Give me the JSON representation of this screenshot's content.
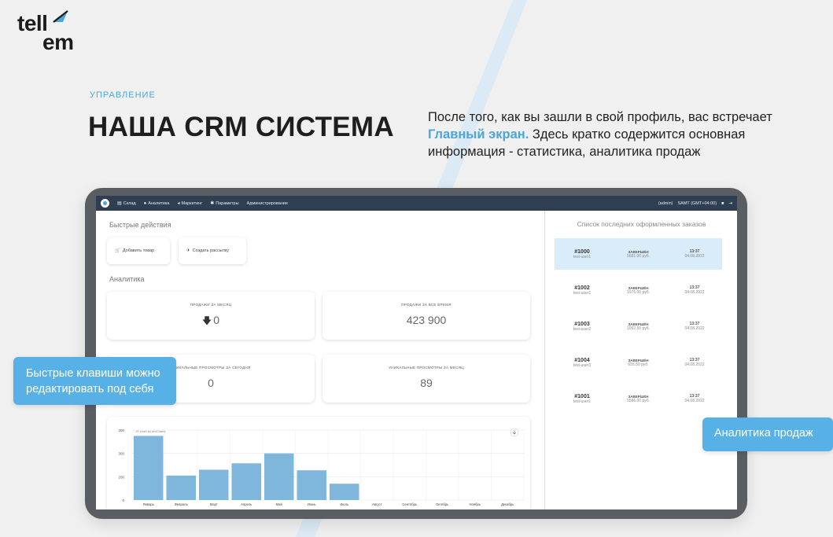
{
  "logo": {
    "part1": "tell",
    "part2": "em"
  },
  "hero": {
    "eyebrow": "УПРАВЛЕНИЕ",
    "title": "НАША CRM СИСТЕМА",
    "lead_before": "После того, как вы зашли в свой профиль, вас встречает ",
    "lead_accent": "Главный экран.",
    "lead_after": " Здесь кратко содержится основная информация - статистика, аналитика продаж"
  },
  "app": {
    "menu": [
      {
        "label": "Склад",
        "icon": "box-icon"
      },
      {
        "label": "Аналитика",
        "icon": "chart-icon"
      },
      {
        "label": "Маркетинг",
        "icon": "megaphone-icon"
      },
      {
        "label": "Параметры",
        "icon": "gear-icon"
      },
      {
        "label": "Администрирование",
        "icon": ""
      }
    ],
    "user": "(admin)",
    "timezone": "SAMT (GMT+04:00)",
    "quick_actions_label": "Быстрые действия",
    "quick_actions": [
      {
        "label": "Добавить товар",
        "icon": "cart-icon"
      },
      {
        "label": "Создать рассылку",
        "icon": "send-icon"
      }
    ],
    "analytics_label": "Аналитика",
    "stats": [
      {
        "caption": "ПРОДАЖИ ЗА МЕСЯЦ",
        "value": "0",
        "trend": "down"
      },
      {
        "caption": "ПРОДАЖИ ЗА ВСЕ ВРЕМЯ",
        "value": "423 900",
        "trend": ""
      },
      {
        "caption": "УНИКАЛЬНЫЕ ПРОСМОТРЫ ЗА СЕГОДНЯ",
        "value": "0",
        "trend": ""
      },
      {
        "caption": "УНИКАЛЬНЫЕ ПРОСМОТРЫ ЗА МЕСЯЦ",
        "value": "89",
        "trend": ""
      }
    ],
    "orders_title": "Список последних оформленных заказов",
    "orders": [
      {
        "number": "#1000",
        "user": "test-user1",
        "status": "ЗАВЕРШЁН",
        "amount": "5681.00 руб.",
        "time": "13:37",
        "date": "04.08.2022",
        "active": true
      },
      {
        "number": "#1002",
        "user": "test-user1",
        "status": "ЗАВЕРШЁН",
        "amount": "1976.00 руб.",
        "time": "13:37",
        "date": "04.08.2022",
        "active": false
      },
      {
        "number": "#1003",
        "user": "test-user2",
        "status": "ЗАВЕРШЁН",
        "amount": "1092.50 руб.",
        "time": "13:37",
        "date": "04.08.2022",
        "active": false
      },
      {
        "number": "#1004",
        "user": "test-user3",
        "status": "ЗАВЕРШЁН",
        "amount": "655.50 руб.",
        "time": "13:37",
        "date": "04.08.2022",
        "active": false
      },
      {
        "number": "#1001",
        "user": "test-user1",
        "status": "ЗАВЕРШЁН",
        "amount": "5586.00 руб.",
        "time": "13:37",
        "date": "04.08.2022",
        "active": false
      }
    ]
  },
  "chart_data": {
    "type": "bar",
    "credit": "JS chart by amCharts",
    "categories": [
      "Январь",
      "Февраль",
      "Март",
      "Апрель",
      "Май",
      "Июнь",
      "Июль",
      "Август",
      "Сентябрь",
      "Октябрь",
      "Ноябрь",
      "Декабрь"
    ],
    "values": [
      550,
      210,
      260,
      315,
      400,
      255,
      140,
      0,
      0,
      0,
      0,
      0
    ],
    "ylim": [
      0,
      600
    ],
    "yticks": [
      0,
      200,
      400,
      600
    ],
    "ytick_labels": [
      "0",
      "200",
      "300",
      "300"
    ],
    "grid": true,
    "bar_color": "#7fb6db"
  },
  "callouts": {
    "left": "Быстрые клавиши можно редактировать под себя",
    "right": "Аналитика продаж"
  }
}
